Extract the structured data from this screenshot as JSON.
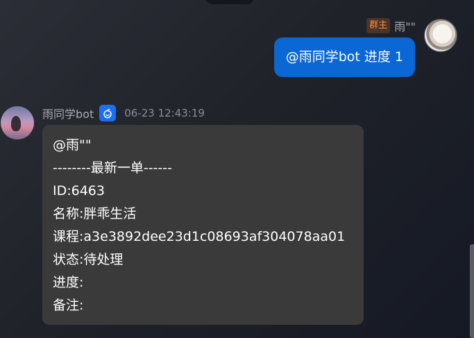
{
  "outgoing": {
    "role_badge": "群主",
    "sender": "雨\"\"",
    "text": "@雨同学bot 进度 1"
  },
  "incoming": {
    "sender": "雨同学bot",
    "timestamp": "06-23 12:43:19",
    "lines": [
      "@雨\"\"",
      "--------最新一单------",
      "ID:6463",
      "名称:胖乖生活",
      "课程:a3e3892dee23d1c08693af304078aa01",
      "状态:待处理",
      "进度:",
      "备注:"
    ]
  },
  "colors": {
    "outgoing_bubble": "#0a67d3",
    "incoming_bubble": "#3a3a3a",
    "role_badge_text": "#ff8a3d",
    "bot_badge": "#1b6ff5"
  }
}
